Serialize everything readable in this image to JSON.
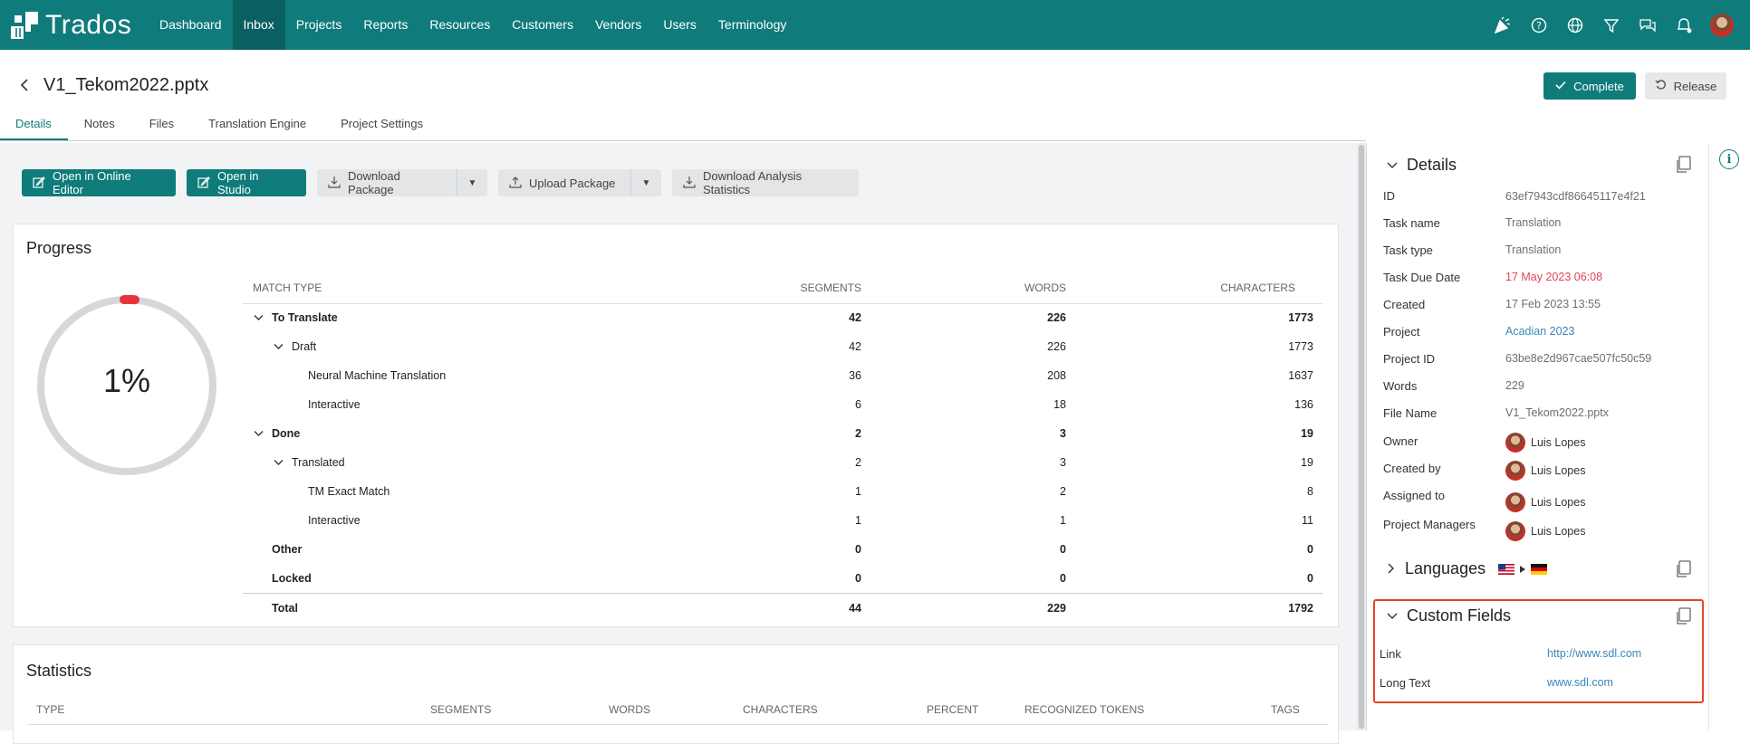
{
  "app": {
    "name": "Trados"
  },
  "nav": {
    "items": [
      {
        "label": "Dashboard"
      },
      {
        "label": "Inbox"
      },
      {
        "label": "Projects"
      },
      {
        "label": "Reports"
      },
      {
        "label": "Resources"
      },
      {
        "label": "Customers"
      },
      {
        "label": "Vendors"
      },
      {
        "label": "Users"
      },
      {
        "label": "Terminology"
      }
    ],
    "active": "Inbox"
  },
  "header": {
    "title": "V1_Tekom2022.pptx",
    "complete_label": "Complete",
    "release_label": "Release"
  },
  "tabs": [
    {
      "label": "Details"
    },
    {
      "label": "Notes"
    },
    {
      "label": "Files"
    },
    {
      "label": "Translation Engine"
    },
    {
      "label": "Project Settings"
    }
  ],
  "toolbar": {
    "open_online_editor": "Open in Online Editor",
    "open_in_studio": "Open in Studio",
    "download_package": "Download Package",
    "upload_package": "Upload Package",
    "download_analysis": "Download Analysis Statistics"
  },
  "progress": {
    "title": "Progress",
    "percent_label": "1%",
    "percent_value": 1,
    "columns": [
      "MATCH TYPE",
      "SEGMENTS",
      "WORDS",
      "CHARACTERS"
    ],
    "rows": [
      {
        "name": "To Translate",
        "segments": "42",
        "words": "226",
        "characters": "1773",
        "level": 0,
        "bold": true,
        "chevron": true
      },
      {
        "name": "Draft",
        "segments": "42",
        "words": "226",
        "characters": "1773",
        "level": 1,
        "bold": false,
        "chevron": true
      },
      {
        "name": "Neural Machine Translation",
        "segments": "36",
        "words": "208",
        "characters": "1637",
        "level": 2,
        "bold": false,
        "chevron": false
      },
      {
        "name": "Interactive",
        "segments": "6",
        "words": "18",
        "characters": "136",
        "level": 2,
        "bold": false,
        "chevron": false
      },
      {
        "name": "Done",
        "segments": "2",
        "words": "3",
        "characters": "19",
        "level": 0,
        "bold": true,
        "chevron": true
      },
      {
        "name": "Translated",
        "segments": "2",
        "words": "3",
        "characters": "19",
        "level": 1,
        "bold": false,
        "chevron": true
      },
      {
        "name": "TM Exact Match",
        "segments": "1",
        "words": "2",
        "characters": "8",
        "level": 2,
        "bold": false,
        "chevron": false
      },
      {
        "name": "Interactive",
        "segments": "1",
        "words": "1",
        "characters": "11",
        "level": 2,
        "bold": false,
        "chevron": false
      },
      {
        "name": "Other",
        "segments": "0",
        "words": "0",
        "characters": "0",
        "level": 0,
        "bold": true,
        "chevron": false
      },
      {
        "name": "Locked",
        "segments": "0",
        "words": "0",
        "characters": "0",
        "level": 0,
        "bold": true,
        "chevron": false
      }
    ],
    "total": {
      "name": "Total",
      "segments": "44",
      "words": "229",
      "characters": "1792"
    }
  },
  "statistics": {
    "title": "Statistics",
    "columns": [
      "TYPE",
      "SEGMENTS",
      "WORDS",
      "CHARACTERS",
      "PERCENT",
      "RECOGNIZED TOKENS",
      "TAGS"
    ]
  },
  "details": {
    "title": "Details",
    "fields": {
      "id": {
        "key": "ID",
        "value": "63ef7943cdf86645117e4f21"
      },
      "task_name": {
        "key": "Task name",
        "value": "Translation"
      },
      "task_type": {
        "key": "Task type",
        "value": "Translation"
      },
      "due_date": {
        "key": "Task Due Date",
        "value": "17 May 2023 06:08"
      },
      "created": {
        "key": "Created",
        "value": "17 Feb 2023 13:55"
      },
      "project": {
        "key": "Project",
        "value": "Acadian 2023"
      },
      "project_id": {
        "key": "Project ID",
        "value": "63be8e2d967cae507fc50c59"
      },
      "words": {
        "key": "Words",
        "value": "229"
      },
      "file_name": {
        "key": "File Name",
        "value": "V1_Tekom2022.pptx"
      },
      "owner": {
        "key": "Owner",
        "value": "Luis Lopes"
      },
      "created_by": {
        "key": "Created by",
        "value": "Luis Lopes"
      },
      "assigned_to": {
        "key": "Assigned to",
        "value": "Luis Lopes"
      },
      "project_managers": {
        "key": "Project Managers",
        "value": "Luis Lopes"
      }
    }
  },
  "languages": {
    "title": "Languages",
    "source_flag": "us-flag-icon",
    "target_flag": "de-flag-icon"
  },
  "custom_fields": {
    "title": "Custom Fields",
    "link": {
      "key": "Link",
      "value": "http://www.sdl.com"
    },
    "long_text": {
      "key": "Long Text",
      "value": "www.sdl.com"
    }
  },
  "colors": {
    "brand": "#0f7b7b",
    "due_date": "#e0455a",
    "link": "#3a87b8",
    "highlight_border": "#e8432e",
    "progress_indicator": "#e8323a"
  }
}
